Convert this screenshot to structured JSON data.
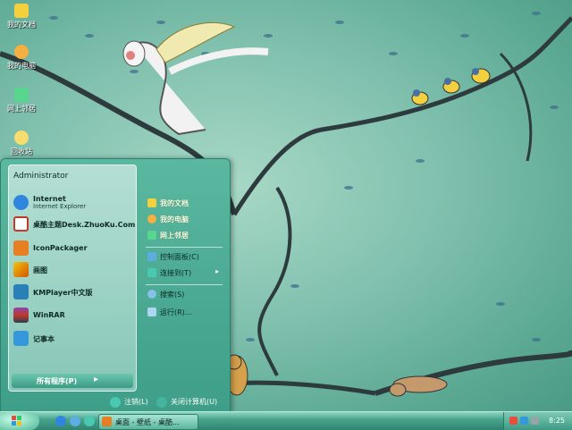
{
  "desktop": {
    "icons": [
      {
        "label": "我的文档",
        "icon": "my-documents-icon",
        "color": "#f4d03f"
      },
      {
        "label": "我的电脑",
        "icon": "my-computer-icon",
        "color": "#f5b041"
      },
      {
        "label": "网上邻居",
        "icon": "network-places-icon",
        "color": "#58d68d"
      },
      {
        "label": "回收站",
        "icon": "recycle-bin-icon",
        "color": "#f7dc6f"
      }
    ]
  },
  "start_menu": {
    "user_name": "Administrator",
    "pinned": [
      {
        "name": "Internet",
        "sub": "Internet Explorer",
        "icon": "internet-explorer-icon",
        "color": "#2e86de"
      },
      {
        "name": "桌酷主题Desk.ZhuoKu.Com",
        "sub": "",
        "icon": "zhuoku-theme-icon",
        "color": "#c0392b"
      }
    ],
    "recent": [
      {
        "name": "IconPackager",
        "icon": "iconpackager-icon",
        "color": "#e67e22"
      },
      {
        "name": "画图",
        "icon": "paint-icon",
        "color": "#d35400"
      },
      {
        "name": "KMPlayer中文版",
        "icon": "kmplayer-icon",
        "color": "#2980b9"
      },
      {
        "name": "WinRAR",
        "icon": "winrar-icon",
        "color": "#8e44ad"
      },
      {
        "name": "记事本",
        "icon": "notepad-icon",
        "color": "#3498db"
      }
    ],
    "all_programs_label": "所有程序(P)",
    "places": [
      {
        "label": "我的文档",
        "icon": "my-documents-icon",
        "color": "#f4d03f",
        "bold": true
      },
      {
        "label": "我的电脑",
        "icon": "my-computer-icon",
        "color": "#f5b041",
        "bold": true
      },
      {
        "label": "网上邻居",
        "icon": "network-places-icon",
        "color": "#58d68d",
        "bold": true
      }
    ],
    "system": [
      {
        "label": "控制面板(C)",
        "icon": "control-panel-icon",
        "color": "#5dade2"
      },
      {
        "label": "连接到(T)",
        "icon": "connect-to-icon",
        "color": "#48c9b0"
      }
    ],
    "tools": [
      {
        "label": "搜索(S)",
        "icon": "search-icon",
        "color": "#85c1e9"
      },
      {
        "label": "运行(R)...",
        "icon": "run-icon",
        "color": "#aed6f1"
      }
    ],
    "logoff_label": "注销(L)",
    "shutdown_label": "关闭计算机(U)"
  },
  "taskbar": {
    "task_label": "桌面 - 壁纸 - 桌酷...",
    "clock": "8:25"
  },
  "colors": {
    "accent": "#3e9e88",
    "taskbar": "#49a48c"
  }
}
